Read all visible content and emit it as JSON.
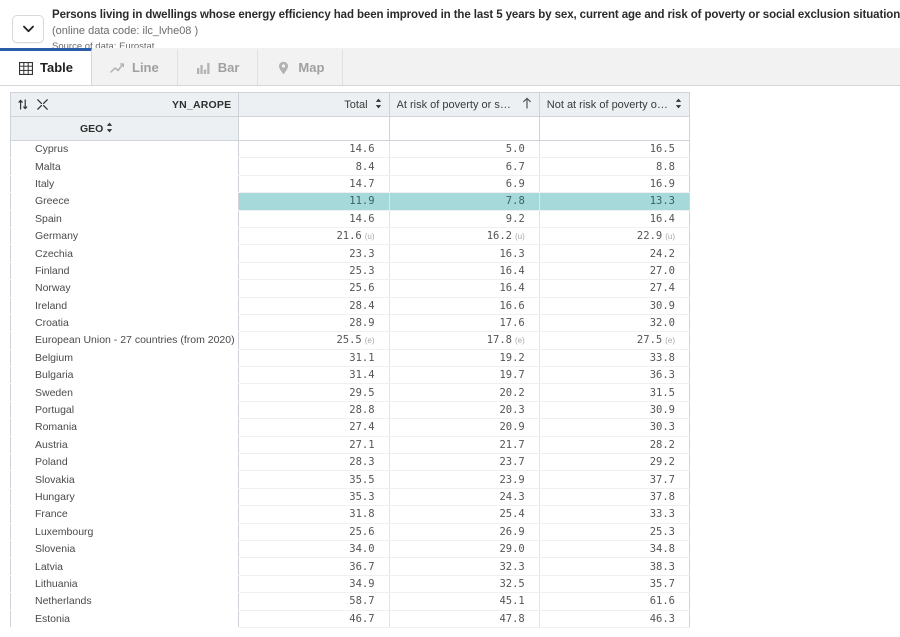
{
  "header": {
    "collapse_icon": "chevron-down-icon",
    "title": "Persons living in dwellings whose energy efficiency had been improved in the last 5 years by sex, current age and risk of poverty or social exclusion situation",
    "data_code": "(online data code: ilc_lvhe08 )",
    "source": "Source of data: Eurostat"
  },
  "tabs": [
    {
      "label": "Table",
      "icon": "table-grid-icon",
      "active": true
    },
    {
      "label": "Line",
      "icon": "line-chart-icon",
      "active": false
    },
    {
      "label": "Bar",
      "icon": "bar-chart-icon",
      "active": false
    },
    {
      "label": "Map",
      "icon": "map-pin-icon",
      "active": false
    }
  ],
  "table": {
    "toolbar": {
      "sort_icon": "sort-updown-icon",
      "collapse_all_icon": "collapse-arrows-icon"
    },
    "dimension_label": "YN_AROPE",
    "geo_label": "GEO",
    "geo_sort_icon": "sort-updown-icon",
    "columns": [
      {
        "label": "Total",
        "sort_icon": "sort-updown-icon"
      },
      {
        "label": "At risk of poverty or soc...",
        "sort_icon": "sort-asc-icon"
      },
      {
        "label": "Not at risk of poverty or ...",
        "sort_icon": "sort-updown-icon"
      }
    ],
    "highlight_color": "#a6d9da",
    "rows": [
      {
        "geo": "Cyprus",
        "values": [
          "14.6",
          "5.0",
          "16.5"
        ],
        "flags": [
          "",
          "",
          ""
        ],
        "highlight": false
      },
      {
        "geo": "Malta",
        "values": [
          "8.4",
          "6.7",
          "8.8"
        ],
        "flags": [
          "",
          "",
          ""
        ],
        "highlight": false
      },
      {
        "geo": "Italy",
        "values": [
          "14.7",
          "6.9",
          "16.9"
        ],
        "flags": [
          "",
          "",
          ""
        ],
        "highlight": false
      },
      {
        "geo": "Greece",
        "values": [
          "11.9",
          "7.8",
          "13.3"
        ],
        "flags": [
          "",
          "",
          ""
        ],
        "highlight": true
      },
      {
        "geo": "Spain",
        "values": [
          "14.6",
          "9.2",
          "16.4"
        ],
        "flags": [
          "",
          "",
          ""
        ],
        "highlight": false
      },
      {
        "geo": "Germany",
        "values": [
          "21.6",
          "16.2",
          "22.9"
        ],
        "flags": [
          "(u)",
          "(u)",
          "(u)"
        ],
        "highlight": false
      },
      {
        "geo": "Czechia",
        "values": [
          "23.3",
          "16.3",
          "24.2"
        ],
        "flags": [
          "",
          "",
          ""
        ],
        "highlight": false
      },
      {
        "geo": "Finland",
        "values": [
          "25.3",
          "16.4",
          "27.0"
        ],
        "flags": [
          "",
          "",
          ""
        ],
        "highlight": false
      },
      {
        "geo": "Norway",
        "values": [
          "25.6",
          "16.4",
          "27.4"
        ],
        "flags": [
          "",
          "",
          ""
        ],
        "highlight": false
      },
      {
        "geo": "Ireland",
        "values": [
          "28.4",
          "16.6",
          "30.9"
        ],
        "flags": [
          "",
          "",
          ""
        ],
        "highlight": false
      },
      {
        "geo": "Croatia",
        "values": [
          "28.9",
          "17.6",
          "32.0"
        ],
        "flags": [
          "",
          "",
          ""
        ],
        "highlight": false
      },
      {
        "geo": "European Union - 27 countries (from 2020)",
        "values": [
          "25.5",
          "17.8",
          "27.5"
        ],
        "flags": [
          "(e)",
          "(e)",
          "(e)"
        ],
        "highlight": false
      },
      {
        "geo": "Belgium",
        "values": [
          "31.1",
          "19.2",
          "33.8"
        ],
        "flags": [
          "",
          "",
          ""
        ],
        "highlight": false
      },
      {
        "geo": "Bulgaria",
        "values": [
          "31.4",
          "19.7",
          "36.3"
        ],
        "flags": [
          "",
          "",
          ""
        ],
        "highlight": false
      },
      {
        "geo": "Sweden",
        "values": [
          "29.5",
          "20.2",
          "31.5"
        ],
        "flags": [
          "",
          "",
          ""
        ],
        "highlight": false
      },
      {
        "geo": "Portugal",
        "values": [
          "28.8",
          "20.3",
          "30.9"
        ],
        "flags": [
          "",
          "",
          ""
        ],
        "highlight": false
      },
      {
        "geo": "Romania",
        "values": [
          "27.4",
          "20.9",
          "30.3"
        ],
        "flags": [
          "",
          "",
          ""
        ],
        "highlight": false
      },
      {
        "geo": "Austria",
        "values": [
          "27.1",
          "21.7",
          "28.2"
        ],
        "flags": [
          "",
          "",
          ""
        ],
        "highlight": false
      },
      {
        "geo": "Poland",
        "values": [
          "28.3",
          "23.7",
          "29.2"
        ],
        "flags": [
          "",
          "",
          ""
        ],
        "highlight": false
      },
      {
        "geo": "Slovakia",
        "values": [
          "35.5",
          "23.9",
          "37.7"
        ],
        "flags": [
          "",
          "",
          ""
        ],
        "highlight": false
      },
      {
        "geo": "Hungary",
        "values": [
          "35.3",
          "24.3",
          "37.8"
        ],
        "flags": [
          "",
          "",
          ""
        ],
        "highlight": false
      },
      {
        "geo": "France",
        "values": [
          "31.8",
          "25.4",
          "33.3"
        ],
        "flags": [
          "",
          "",
          ""
        ],
        "highlight": false
      },
      {
        "geo": "Luxembourg",
        "values": [
          "25.6",
          "26.9",
          "25.3"
        ],
        "flags": [
          "",
          "",
          ""
        ],
        "highlight": false
      },
      {
        "geo": "Slovenia",
        "values": [
          "34.0",
          "29.0",
          "34.8"
        ],
        "flags": [
          "",
          "",
          ""
        ],
        "highlight": false
      },
      {
        "geo": "Latvia",
        "values": [
          "36.7",
          "32.3",
          "38.3"
        ],
        "flags": [
          "",
          "",
          ""
        ],
        "highlight": false
      },
      {
        "geo": "Lithuania",
        "values": [
          "34.9",
          "32.5",
          "35.7"
        ],
        "flags": [
          "",
          "",
          ""
        ],
        "highlight": false
      },
      {
        "geo": "Netherlands",
        "values": [
          "58.7",
          "45.1",
          "61.6"
        ],
        "flags": [
          "",
          "",
          ""
        ],
        "highlight": false
      },
      {
        "geo": "Estonia",
        "values": [
          "46.7",
          "47.8",
          "46.3"
        ],
        "flags": [
          "",
          "",
          ""
        ],
        "highlight": false
      }
    ]
  }
}
